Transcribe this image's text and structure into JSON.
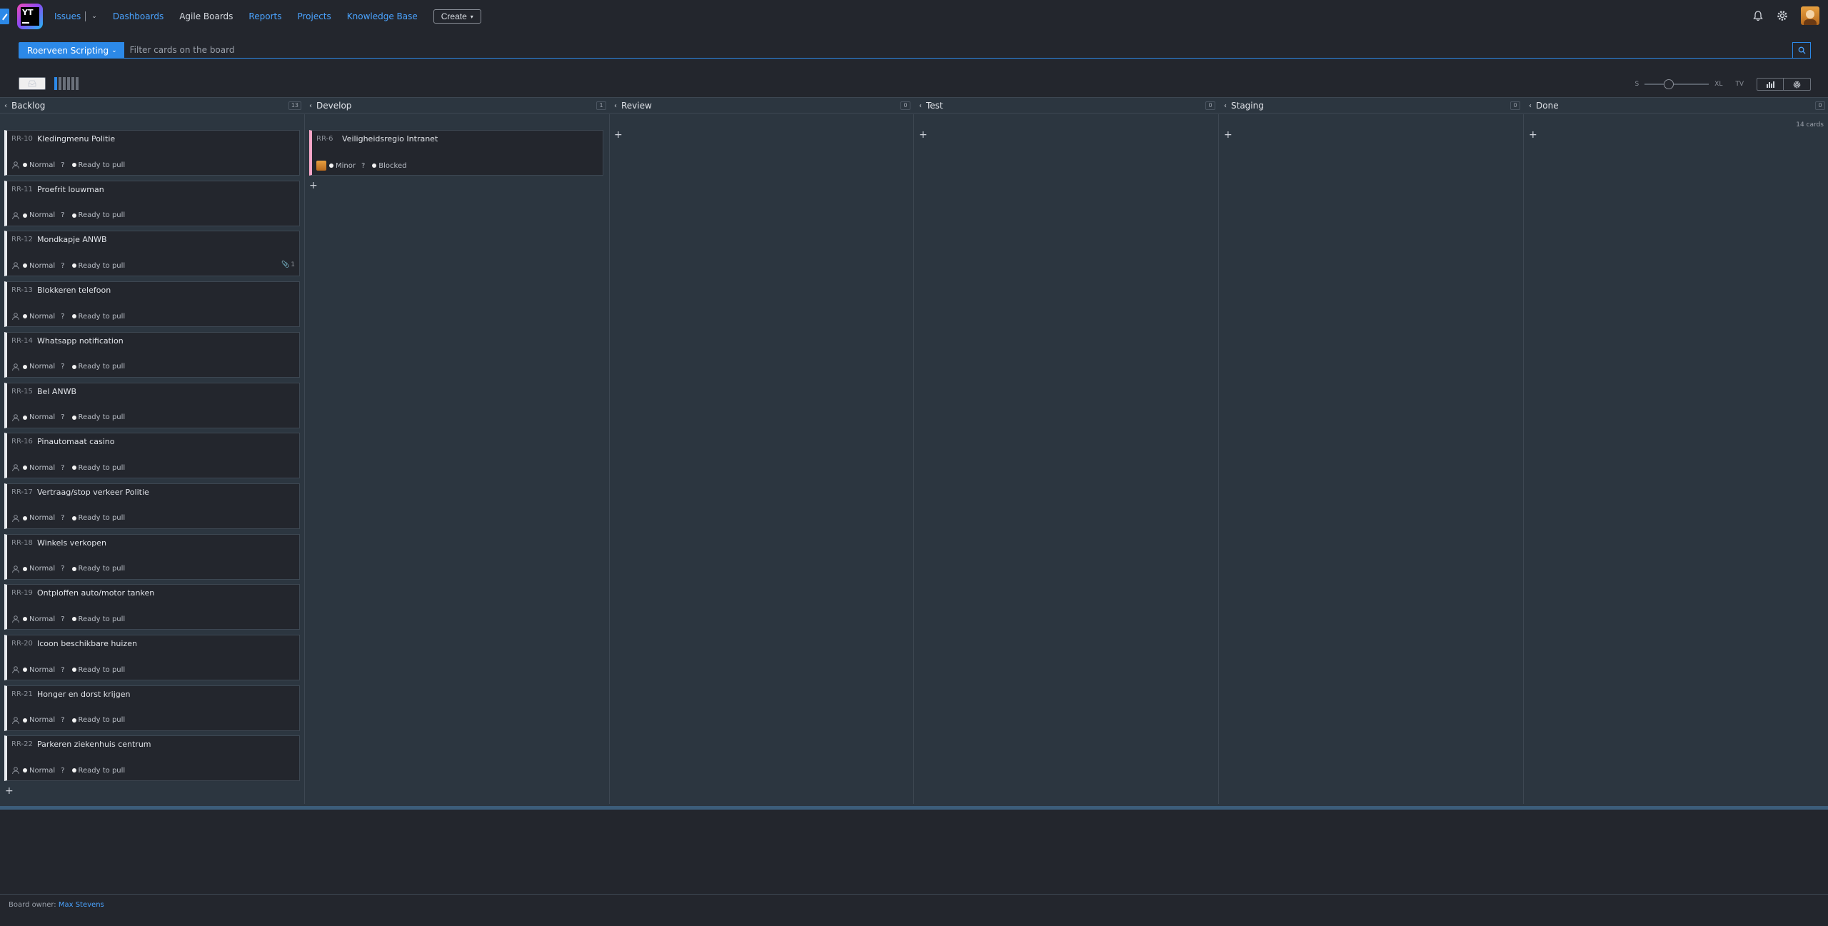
{
  "header": {
    "logo_text": "YT",
    "nav": [
      {
        "label": "Issues",
        "active": false
      },
      {
        "label": "Dashboards",
        "active": false
      },
      {
        "label": "Agile Boards",
        "active": true
      },
      {
        "label": "Reports",
        "active": false
      },
      {
        "label": "Projects",
        "active": false
      },
      {
        "label": "Knowledge Base",
        "active": false
      }
    ],
    "create_label": "Create"
  },
  "search": {
    "project": "Roerveen Scripting",
    "placeholder": "Filter cards on the board"
  },
  "toolbar": {
    "zoom_min": "S",
    "zoom_max": "XL",
    "tv": "TV",
    "zoom_level": 0.35
  },
  "board": {
    "cards_total": "14 cards",
    "columns": [
      {
        "name": "Backlog",
        "count": "13"
      },
      {
        "name": "Develop",
        "count": "1"
      },
      {
        "name": "Review",
        "count": "0"
      },
      {
        "name": "Test",
        "count": "0"
      },
      {
        "name": "Staging",
        "count": "0"
      },
      {
        "name": "Done",
        "count": "0"
      }
    ],
    "backlog_cards": [
      {
        "id": "RR-10",
        "title": "Kledingmenu Politie",
        "priority": "Normal",
        "estimate": "?",
        "state": "Ready to pull"
      },
      {
        "id": "RR-11",
        "title": "Proefrit louwman",
        "priority": "Normal",
        "estimate": "?",
        "state": "Ready to pull"
      },
      {
        "id": "RR-12",
        "title": "Mondkapje ANWB",
        "priority": "Normal",
        "estimate": "?",
        "state": "Ready to pull",
        "attachments": "1"
      },
      {
        "id": "RR-13",
        "title": "Blokkeren telefoon",
        "priority": "Normal",
        "estimate": "?",
        "state": "Ready to pull"
      },
      {
        "id": "RR-14",
        "title": "Whatsapp notification",
        "priority": "Normal",
        "estimate": "?",
        "state": "Ready to pull"
      },
      {
        "id": "RR-15",
        "title": "Bel ANWB",
        "priority": "Normal",
        "estimate": "?",
        "state": "Ready to pull"
      },
      {
        "id": "RR-16",
        "title": "Pinautomaat casino",
        "priority": "Normal",
        "estimate": "?",
        "state": "Ready to pull"
      },
      {
        "id": "RR-17",
        "title": "Vertraag/stop verkeer Politie",
        "priority": "Normal",
        "estimate": "?",
        "state": "Ready to pull"
      },
      {
        "id": "RR-18",
        "title": "Winkels verkopen",
        "priority": "Normal",
        "estimate": "?",
        "state": "Ready to pull"
      },
      {
        "id": "RR-19",
        "title": "Ontploffen auto/motor tanken",
        "priority": "Normal",
        "estimate": "?",
        "state": "Ready to pull"
      },
      {
        "id": "RR-20",
        "title": "Icoon beschikbare huizen",
        "priority": "Normal",
        "estimate": "?",
        "state": "Ready to pull"
      },
      {
        "id": "RR-21",
        "title": "Honger en dorst krijgen",
        "priority": "Normal",
        "estimate": "?",
        "state": "Ready to pull"
      },
      {
        "id": "RR-22",
        "title": "Parkeren ziekenhuis centrum",
        "priority": "Normal",
        "estimate": "?",
        "state": "Ready to pull"
      }
    ],
    "develop_cards": [
      {
        "id": "RR-6",
        "title": "Veiligheidsregio Intranet",
        "priority": "Minor",
        "estimate": "?",
        "state": "Blocked"
      }
    ]
  },
  "footer": {
    "owner_label": "Board owner:",
    "owner_name": "Max Stevens"
  },
  "colors": {
    "accent": "#2c89e8",
    "background": "#23262d",
    "board": "#2c3640",
    "minor_strip": "#f8a6c8"
  }
}
